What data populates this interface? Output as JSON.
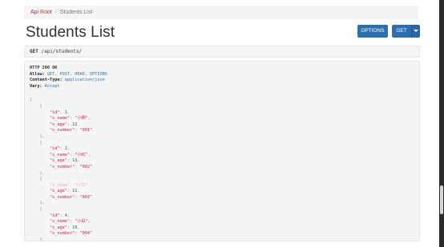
{
  "breadcrumb": {
    "root": "Api Root",
    "separator": "/",
    "current": "Students List"
  },
  "page_title": "Students List",
  "buttons": {
    "options": "OPTIONS",
    "get": "GET"
  },
  "request": {
    "method": "GET",
    "path": "/api/students/"
  },
  "response": {
    "status": "HTTP 200 OK",
    "headers": [
      {
        "name": "Allow:",
        "value": "GET, POST, HEAD, OPTIONS"
      },
      {
        "name": "Content-Type:",
        "value": "application/json"
      },
      {
        "name": "Vary:",
        "value": "Accept"
      }
    ]
  },
  "students": [
    {
      "id": "1",
      "s_name": "\"小明\"",
      "s_age": "12",
      "s_number": "\"001\""
    },
    {
      "id": "2",
      "s_name": "\"小红\"",
      "s_age": "13",
      "s_number": "\"002\""
    },
    {
      "id": "3",
      "s_name": "\"小华\"",
      "s_age": "11",
      "s_number": "\"003\""
    },
    {
      "id": "4",
      "s_name": "\"小白\"",
      "s_age": "10",
      "s_number": "\"004\""
    }
  ],
  "json_keys": {
    "id": "\"id\"",
    "s_name": "\"s_name\"",
    "s_age": "\"s_age\"",
    "s_number": "\"s_number\""
  },
  "colors": {
    "primary": "#2c6fb1",
    "breadcrumb_link": "#c9302c",
    "json_key": "#c7254e",
    "json_number": "#1f6f3f"
  }
}
